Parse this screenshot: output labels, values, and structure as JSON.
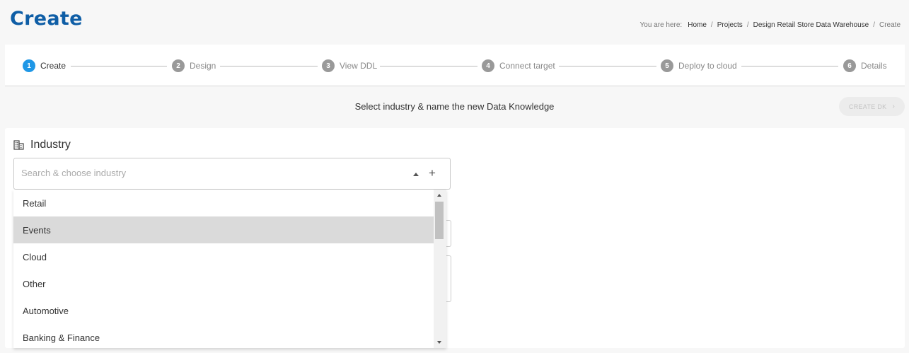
{
  "page": {
    "title": "Create"
  },
  "breadcrumb": {
    "prefix": "You are here:",
    "items": [
      "Home",
      "Projects",
      "Design Retail Store Data Warehouse"
    ],
    "current": "Create",
    "separator": "/"
  },
  "stepper": {
    "active_color": "#1f97e6",
    "steps": [
      {
        "num": "1",
        "label": "Create",
        "active": true
      },
      {
        "num": "2",
        "label": "Design"
      },
      {
        "num": "3",
        "label": "View DDL"
      },
      {
        "num": "4",
        "label": "Connect target"
      },
      {
        "num": "5",
        "label": "Deploy to cloud"
      },
      {
        "num": "6",
        "label": "Details"
      }
    ]
  },
  "instruction": "Select industry & name the new Data Knowledge",
  "create_button": {
    "label": "CREATE DK",
    "icon": "chevron-right-icon",
    "disabled": true
  },
  "industry": {
    "label": "Industry",
    "icon": "building-icon",
    "search_placeholder": "Search & choose industry",
    "search_value": "",
    "options": [
      "Retail",
      "Events",
      "Cloud",
      "Other",
      "Automotive",
      "Banking & Finance"
    ],
    "hovered_option": "Events"
  },
  "colors": {
    "title": "#0f5ea6",
    "hover_row": "#dadada"
  }
}
